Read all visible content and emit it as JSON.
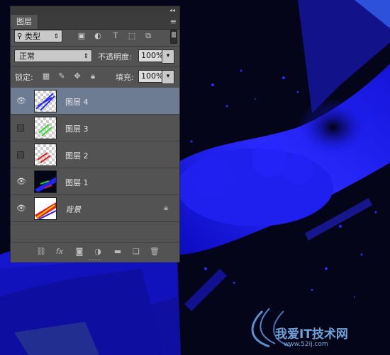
{
  "panel": {
    "collapse_icon": "double-chevron",
    "tab_label": "图层",
    "menu_icon": "panel-menu"
  },
  "filter": {
    "kind_label": "类型",
    "icons": [
      "search-icon",
      "image-filter-icon",
      "adjustment-filter-icon",
      "type-filter-icon",
      "shape-filter-icon",
      "smart-object-filter-icon"
    ]
  },
  "blend": {
    "mode": "正常",
    "opacity_label": "不透明度:",
    "opacity_value": "100%"
  },
  "lock": {
    "label": "锁定:",
    "fill_label": "填充:",
    "fill_value": "100%"
  },
  "layers": [
    {
      "name": "图层 4",
      "visible": true,
      "selected": true
    },
    {
      "name": "图层 3",
      "visible": false,
      "selected": false
    },
    {
      "name": "图层 2",
      "visible": false,
      "selected": false
    },
    {
      "name": "图层 1",
      "visible": true,
      "selected": false
    },
    {
      "name": "背景",
      "visible": true,
      "selected": false,
      "locked": true
    }
  ],
  "bottom_icons": [
    "link-layers-icon",
    "fx-icon",
    "layer-mask-icon",
    "adjustment-layer-icon",
    "group-icon",
    "new-layer-icon",
    "delete-icon"
  ],
  "bottom_fx_label": "fx",
  "watermark": {
    "text": "我爱IT技术网",
    "url": "www.52ij.com"
  },
  "colors": {
    "background": "#05051a",
    "splash": "#1f1fe6",
    "selected_layer": "#6d7c93",
    "panel": "#535353"
  }
}
